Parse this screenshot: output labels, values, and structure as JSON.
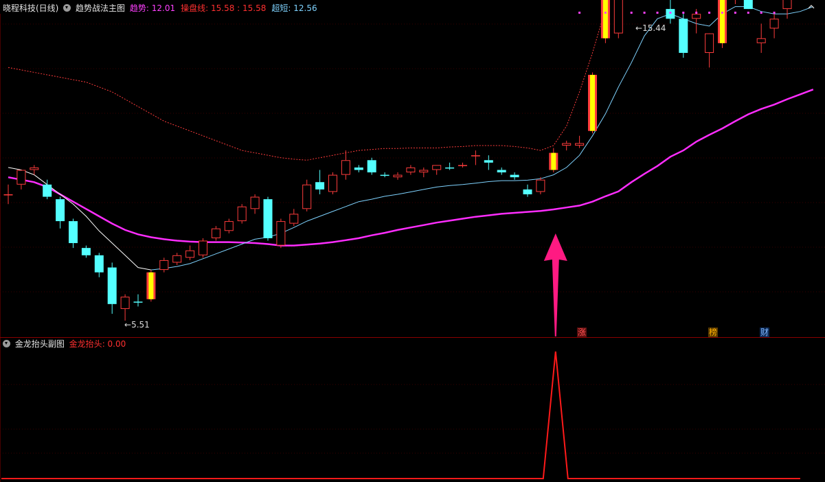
{
  "main_panel": {
    "stock_name": "晓程科技(日线)",
    "indicator_name": "趋势战法主图",
    "legend": [
      {
        "label": "趋势",
        "sep": ": ",
        "value": "12.01",
        "label_color": "#ff40ff",
        "value_color": "#ff40ff"
      },
      {
        "label": "操盘线",
        "sep": ": ",
        "value": "15.58 : 15.58",
        "label_color": "#ff3030",
        "value_color": "#ff3030"
      },
      {
        "label": "超短",
        "sep": ": ",
        "value": "12.56",
        "label_color": "#7fd3ff",
        "value_color": "#7fd3ff"
      }
    ],
    "high_label": "15.44",
    "low_label": "5.51",
    "event_badges": [
      {
        "text": "涨",
        "color": "#ff5050"
      },
      {
        "text": "榜",
        "color": "#ffb000"
      },
      {
        "text": "财",
        "color": "#7fb7ff"
      }
    ]
  },
  "sub_panel": {
    "indicator_name": "金龙抬头副图",
    "legend": [
      {
        "label": "金龙抬头",
        "sep": ": ",
        "value": "0.00",
        "label_color": "#ff3030",
        "value_color": "#ff3030"
      }
    ]
  },
  "colors": {
    "up_candle": "#ff3c3c",
    "down_candle": "#54ffff",
    "trend_line": "#ff2dff",
    "signal_candle": "#ffff00",
    "arrow": "#ff1a82",
    "fast_line": "#ffffff",
    "sub_line": "#ff1a1a"
  },
  "chart_data": {
    "type": "candlestick",
    "price_range": [
      5.51,
      15.44
    ],
    "candles": [
      {
        "o": 8.1,
        "h": 8.3,
        "l": 7.9,
        "c": 8.1,
        "kind": "up"
      },
      {
        "o": 8.3,
        "h": 8.6,
        "l": 8.2,
        "c": 8.6,
        "kind": "up"
      },
      {
        "o": 8.6,
        "h": 8.7,
        "l": 8.5,
        "c": 8.65,
        "kind": "up"
      },
      {
        "o": 8.3,
        "h": 8.4,
        "l": 8.0,
        "c": 8.05,
        "kind": "down"
      },
      {
        "o": 8.0,
        "h": 8.05,
        "l": 7.4,
        "c": 7.55,
        "kind": "down"
      },
      {
        "o": 7.55,
        "h": 7.6,
        "l": 7.0,
        "c": 7.1,
        "kind": "down"
      },
      {
        "o": 7.0,
        "h": 7.05,
        "l": 6.8,
        "c": 6.85,
        "kind": "down"
      },
      {
        "o": 6.85,
        "h": 6.9,
        "l": 6.4,
        "c": 6.5,
        "kind": "down"
      },
      {
        "o": 6.6,
        "h": 6.7,
        "l": 5.65,
        "c": 5.85,
        "kind": "down"
      },
      {
        "o": 5.75,
        "h": 6.05,
        "l": 5.51,
        "c": 6.0,
        "kind": "up"
      },
      {
        "o": 5.9,
        "h": 6.05,
        "l": 5.8,
        "c": 5.9,
        "kind": "down"
      },
      {
        "o": 5.95,
        "h": 6.55,
        "l": 5.9,
        "c": 6.5,
        "kind": "signal"
      },
      {
        "o": 6.55,
        "h": 6.8,
        "l": 6.5,
        "c": 6.75,
        "kind": "up"
      },
      {
        "o": 6.7,
        "h": 6.9,
        "l": 6.65,
        "c": 6.85,
        "kind": "up"
      },
      {
        "o": 6.8,
        "h": 7.05,
        "l": 6.75,
        "c": 6.95,
        "kind": "up"
      },
      {
        "o": 6.85,
        "h": 7.2,
        "l": 6.8,
        "c": 7.15,
        "kind": "up"
      },
      {
        "o": 7.2,
        "h": 7.45,
        "l": 7.15,
        "c": 7.4,
        "kind": "up"
      },
      {
        "o": 7.35,
        "h": 7.6,
        "l": 7.3,
        "c": 7.55,
        "kind": "up"
      },
      {
        "o": 7.55,
        "h": 7.9,
        "l": 7.5,
        "c": 7.85,
        "kind": "up"
      },
      {
        "o": 7.8,
        "h": 8.1,
        "l": 7.7,
        "c": 8.05,
        "kind": "up"
      },
      {
        "o": 8.0,
        "h": 8.05,
        "l": 7.15,
        "c": 7.2,
        "kind": "down"
      },
      {
        "o": 7.05,
        "h": 7.6,
        "l": 7.0,
        "c": 7.55,
        "kind": "up"
      },
      {
        "o": 7.5,
        "h": 7.8,
        "l": 7.45,
        "c": 7.7,
        "kind": "up"
      },
      {
        "o": 7.8,
        "h": 8.4,
        "l": 7.75,
        "c": 8.3,
        "kind": "up"
      },
      {
        "o": 8.35,
        "h": 8.6,
        "l": 8.1,
        "c": 8.2,
        "kind": "down"
      },
      {
        "o": 8.15,
        "h": 8.55,
        "l": 8.1,
        "c": 8.5,
        "kind": "up"
      },
      {
        "o": 8.5,
        "h": 9.0,
        "l": 8.4,
        "c": 8.8,
        "kind": "up"
      },
      {
        "o": 8.65,
        "h": 8.7,
        "l": 8.55,
        "c": 8.6,
        "kind": "down"
      },
      {
        "o": 8.55,
        "h": 8.85,
        "l": 8.5,
        "c": 8.8,
        "kind": "down"
      },
      {
        "o": 8.5,
        "h": 8.55,
        "l": 8.45,
        "c": 8.5,
        "kind": "down"
      },
      {
        "o": 8.45,
        "h": 8.55,
        "l": 8.4,
        "c": 8.5,
        "kind": "up"
      },
      {
        "o": 8.55,
        "h": 8.7,
        "l": 8.5,
        "c": 8.65,
        "kind": "up"
      },
      {
        "o": 8.6,
        "h": 8.65,
        "l": 8.45,
        "c": 8.55,
        "kind": "up"
      },
      {
        "o": 8.6,
        "h": 8.7,
        "l": 8.5,
        "c": 8.7,
        "kind": "up"
      },
      {
        "o": 8.65,
        "h": 8.75,
        "l": 8.6,
        "c": 8.65,
        "kind": "down"
      },
      {
        "o": 8.7,
        "h": 8.75,
        "l": 8.65,
        "c": 8.7,
        "kind": "up"
      },
      {
        "o": 8.9,
        "h": 9.0,
        "l": 8.7,
        "c": 8.9,
        "kind": "up"
      },
      {
        "o": 8.8,
        "h": 8.9,
        "l": 8.6,
        "c": 8.75,
        "kind": "down"
      },
      {
        "o": 8.6,
        "h": 8.65,
        "l": 8.5,
        "c": 8.55,
        "kind": "down"
      },
      {
        "o": 8.5,
        "h": 8.55,
        "l": 8.4,
        "c": 8.45,
        "kind": "down"
      },
      {
        "o": 8.2,
        "h": 8.3,
        "l": 8.05,
        "c": 8.1,
        "kind": "down"
      },
      {
        "o": 8.15,
        "h": 8.45,
        "l": 8.1,
        "c": 8.4,
        "kind": "up"
      },
      {
        "o": 8.6,
        "h": 9.05,
        "l": 8.55,
        "c": 8.95,
        "kind": "signal"
      },
      {
        "o": 9.1,
        "h": 9.2,
        "l": 9.0,
        "c": 9.15,
        "kind": "up"
      },
      {
        "o": 9.1,
        "h": 9.3,
        "l": 9.05,
        "c": 9.15,
        "kind": "up"
      },
      {
        "o": 9.4,
        "h": 10.6,
        "l": 9.35,
        "c": 10.55,
        "kind": "signal"
      },
      {
        "o": 11.3,
        "h": 12.5,
        "l": 11.2,
        "c": 12.4,
        "kind": "signal"
      },
      {
        "o": 11.4,
        "h": 12.2,
        "l": 11.3,
        "c": 12.1,
        "kind": "up"
      },
      {
        "o": 13.1,
        "h": 13.5,
        "l": 13.05,
        "c": 13.45,
        "kind": "signal"
      },
      {
        "o": 13.5,
        "h": 15.44,
        "l": 13.3,
        "c": 13.7,
        "kind": "up"
      },
      {
        "o": 14.3,
        "h": 14.4,
        "l": 13.7,
        "c": 13.8,
        "kind": "down"
      },
      {
        "o": 11.9,
        "h": 12.6,
        "l": 11.6,
        "c": 11.7,
        "kind": "down"
      },
      {
        "o": 11.7,
        "h": 11.8,
        "l": 10.9,
        "c": 11.0,
        "kind": "down"
      },
      {
        "o": 11.7,
        "h": 11.9,
        "l": 11.4,
        "c": 11.8,
        "kind": "up"
      },
      {
        "o": 11.0,
        "h": 11.1,
        "l": 10.7,
        "c": 11.4,
        "kind": "up"
      },
      {
        "o": 11.2,
        "h": 12.8,
        "l": 11.1,
        "c": 12.7,
        "kind": "signal"
      },
      {
        "o": 12.1,
        "h": 13.3,
        "l": 12.0,
        "c": 12.9,
        "kind": "up"
      },
      {
        "o": 12.4,
        "h": 13.6,
        "l": 11.9,
        "c": 11.9,
        "kind": "down"
      },
      {
        "o": 11.2,
        "h": 11.6,
        "l": 11.0,
        "c": 11.3,
        "kind": "up"
      },
      {
        "o": 11.5,
        "h": 11.8,
        "l": 11.3,
        "c": 11.7,
        "kind": "up"
      },
      {
        "o": 11.9,
        "h": 12.2,
        "l": 11.7,
        "c": 12.1,
        "kind": "up"
      },
      {
        "o": 12.4,
        "h": 12.7,
        "l": 12.2,
        "c": 12.56,
        "kind": "up"
      }
    ],
    "trend_line": [
      8.45,
      8.4,
      8.35,
      8.25,
      8.1,
      7.95,
      7.8,
      7.65,
      7.5,
      7.37,
      7.28,
      7.22,
      7.18,
      7.15,
      7.13,
      7.12,
      7.12,
      7.12,
      7.11,
      7.1,
      7.08,
      7.05,
      7.05,
      7.07,
      7.09,
      7.12,
      7.16,
      7.2,
      7.26,
      7.31,
      7.37,
      7.42,
      7.47,
      7.52,
      7.56,
      7.6,
      7.64,
      7.67,
      7.7,
      7.72,
      7.74,
      7.76,
      7.79,
      7.83,
      7.87,
      7.95,
      8.06,
      8.16,
      8.35,
      8.52,
      8.68,
      8.87,
      9.0,
      9.18,
      9.32,
      9.45,
      9.6,
      9.74,
      9.85,
      9.94,
      10.05,
      10.15,
      10.25
    ],
    "fast_line": [
      8.65,
      8.6,
      8.5,
      8.3,
      8.1,
      7.9,
      7.65,
      7.35,
      7.1,
      6.85,
      6.6,
      6.55,
      6.58,
      6.62,
      6.68,
      6.78,
      6.88,
      6.98,
      7.08,
      7.18,
      7.22,
      7.3,
      7.42,
      7.55,
      7.65,
      7.75,
      7.85,
      7.95,
      8.0,
      8.06,
      8.1,
      8.15,
      8.2,
      8.25,
      8.28,
      8.3,
      8.33,
      8.36,
      8.38,
      8.38,
      8.39,
      8.42,
      8.5,
      8.65,
      8.9,
      9.3,
      9.75,
      10.3,
      10.8,
      11.35,
      11.7,
      11.8,
      11.7,
      11.6,
      11.55,
      11.8,
      11.95,
      11.95,
      11.85,
      11.8,
      11.8,
      11.85,
      11.95
    ],
    "upper_band": [
      10.7,
      10.65,
      10.6,
      10.55,
      10.5,
      10.45,
      10.4,
      10.3,
      10.2,
      10.05,
      9.9,
      9.75,
      9.6,
      9.5,
      9.4,
      9.3,
      9.2,
      9.1,
      9.0,
      8.95,
      8.9,
      8.85,
      8.82,
      8.8,
      8.85,
      8.9,
      8.95,
      9.0,
      9.02,
      9.04,
      9.04,
      9.05,
      9.05,
      9.05,
      9.07,
      9.08,
      9.1,
      9.1,
      9.1,
      9.08,
      9.05,
      9.0,
      9.1,
      9.5,
      10.2,
      11.0,
      11.9,
      12.8,
      13.5,
      14.1,
      14.5,
      14.7,
      14.85,
      15.0,
      15.2,
      15.3,
      15.35,
      15.38,
      15.4,
      15.38,
      15.36,
      15.3,
      15.25
    ],
    "up_markers": [
      44,
      46,
      48,
      49,
      50,
      51,
      52,
      53,
      54,
      55,
      56,
      57,
      58,
      59
    ],
    "sub_signal": {
      "index": 42,
      "value": 1,
      "baseline": 0
    }
  }
}
